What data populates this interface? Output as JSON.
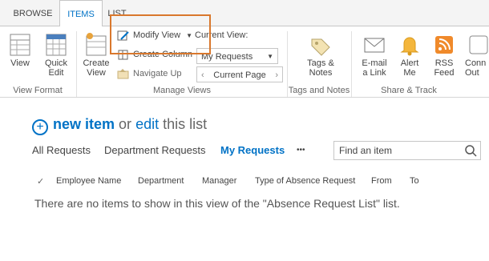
{
  "tabs": [
    "BROWSE",
    "ITEMS",
    "LIST"
  ],
  "ribbon": {
    "view": "View",
    "quick_edit": "Quick Edit",
    "create_view": "Create View",
    "modify_view": "Modify View",
    "create_column": "Create Column",
    "navigate_up": "Navigate Up",
    "current_view_label": "Current View:",
    "current_view_value": "My Requests",
    "current_page": "Current Page",
    "tags_notes": "Tags & Notes",
    "email_link": "E-mail a Link",
    "alert_me": "Alert Me",
    "rss_feed": "RSS Feed",
    "connect": "Conn Out",
    "groups": [
      "View Format",
      "Manage Views",
      "Tags and Notes",
      "Share & Track"
    ]
  },
  "main": {
    "new_item": "new item",
    "or": "or",
    "edit": "edit",
    "this_list": "this list",
    "views": [
      "All Requests",
      "Department Requests",
      "My Requests",
      "•••"
    ],
    "search_placeholder": "Find an item",
    "columns": [
      "Employee Name",
      "Department",
      "Manager",
      "Type of Absence Request",
      "From",
      "To"
    ],
    "empty_message": "There are no items to show in this view of the \"Absence Request List\" list."
  }
}
